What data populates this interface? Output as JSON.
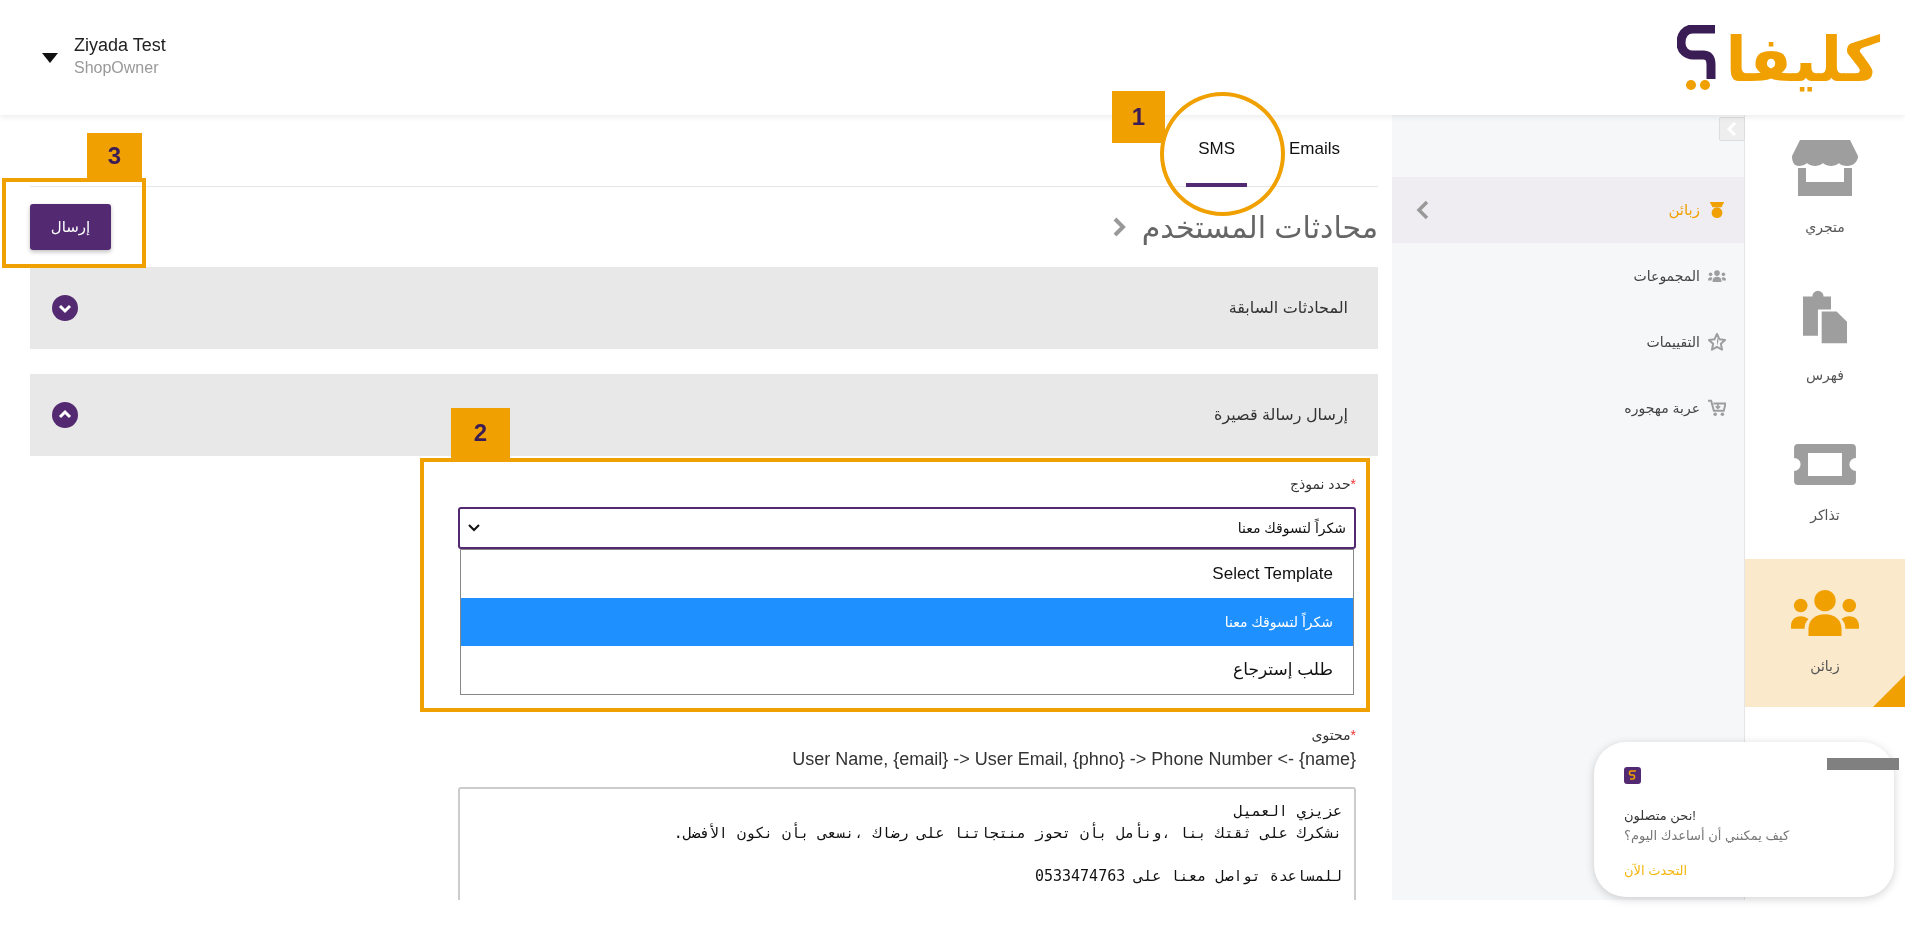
{
  "header": {
    "logo_text": "كليفا",
    "user_name": "Ziyada Test",
    "user_role": "ShopOwner"
  },
  "rail": [
    {
      "label": "متجري",
      "kind": "store",
      "selected": false
    },
    {
      "label": "فهرس",
      "kind": "catalog",
      "selected": false
    },
    {
      "label": "تذاكر",
      "kind": "ticket",
      "selected": false
    },
    {
      "label": "زبائن",
      "kind": "users",
      "selected": true
    }
  ],
  "submenu": [
    {
      "label": "زبائن",
      "kind": "badge",
      "selected": true
    },
    {
      "label": "المجموعات",
      "kind": "users",
      "selected": false
    },
    {
      "label": "التقييمات",
      "kind": "star",
      "selected": false
    },
    {
      "label": "عربة مهجوره",
      "kind": "cart",
      "selected": false
    }
  ],
  "tabs": [
    {
      "label": "Emails",
      "selected": false
    },
    {
      "label": "SMS",
      "selected": true
    }
  ],
  "page_title": "محادثات المستخدم",
  "send_button": "إرسال",
  "sections": [
    {
      "title": "المحادثات السابقة",
      "expanded": false
    },
    {
      "title": "إرسال رسالة قصيرة",
      "expanded": true
    }
  ],
  "form": {
    "template_label": {
      "text": "حدد نموذج",
      "mark": "*"
    },
    "template_value": "شكراً لتسوقك معنا",
    "template_options": [
      {
        "label": "Select Template",
        "selected": false
      },
      {
        "label": "شكراً لتسوقك معنا",
        "selected": true
      },
      {
        "label": "طلب إسترجاع",
        "selected": false
      }
    ],
    "content_label": {
      "text": "محتوى",
      "mark": "*"
    },
    "content_hint": "User Name, {email} -> User Email, {phno} -> Phone Number <- {name}",
    "content_paragraphs": [
      [
        "عزيزي العميل",
        "نشكرك على ثقتك بنا ،ونأمل بأن تحوز منتجاتنا على رضاك ،نسعى بأن نكون الأفضل."
      ],
      [
        "للمساعدة تواصل معنا على 0533474763"
      ]
    ]
  },
  "chat": {
    "title": "!نحن متصلون",
    "message": "كيف يمكنني أن أساعدك اليوم؟",
    "link": "التحدث الآن"
  },
  "annotations": [
    {
      "label": "1",
      "kind": "circle"
    },
    {
      "label": "2",
      "kind": "box"
    },
    {
      "label": "3",
      "kind": "box"
    }
  ]
}
